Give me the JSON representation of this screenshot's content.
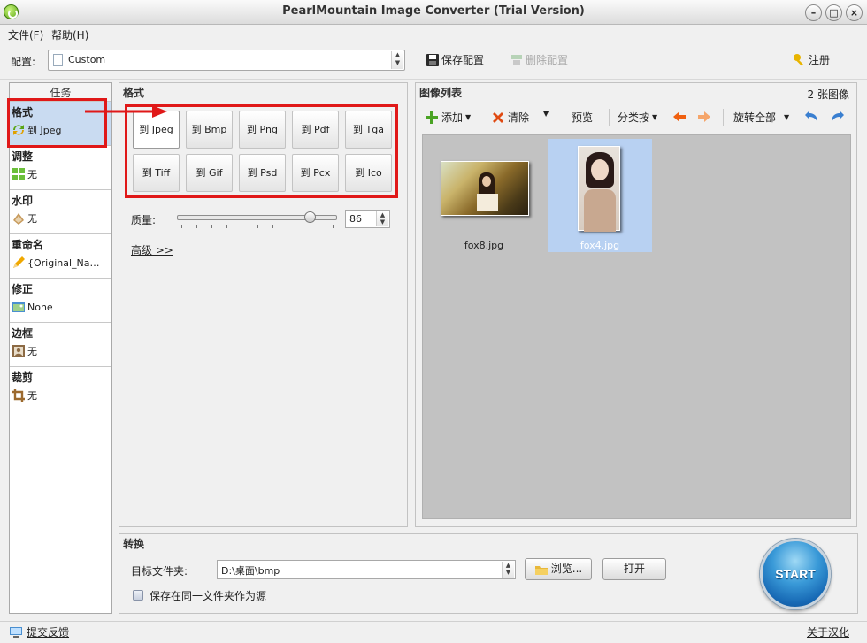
{
  "window": {
    "title": "PearlMountain Image Converter (Trial Version)"
  },
  "menu": {
    "file": "文件(F)",
    "help": "帮助(H)"
  },
  "config": {
    "label": "配置:",
    "value": "Custom",
    "save": "保存配置",
    "delete": "删除配置",
    "register": "注册"
  },
  "tasks": {
    "header": "任务",
    "items": [
      {
        "title": "格式",
        "value": "到 Jpeg",
        "icon": "convert-arrows-icon"
      },
      {
        "title": "调整",
        "value": "无",
        "icon": "resize-grid-icon"
      },
      {
        "title": "水印",
        "value": "无",
        "icon": "watermark-icon"
      },
      {
        "title": "重命名",
        "value": "{Original_Na…",
        "icon": "pencil-icon"
      },
      {
        "title": "修正",
        "value": "None",
        "icon": "picture-adjust-icon"
      },
      {
        "title": "边框",
        "value": "无",
        "icon": "portrait-frame-icon"
      },
      {
        "title": "裁剪",
        "value": "无",
        "icon": "crop-icon"
      }
    ]
  },
  "format": {
    "title": "格式",
    "buttons": [
      "到 Jpeg",
      "到 Bmp",
      "到 Png",
      "到 Pdf",
      "到 Tga",
      "到 Tiff",
      "到 Gif",
      "到 Psd",
      "到 Pcx",
      "到 Ico"
    ],
    "quality_label": "质量:",
    "quality": 86,
    "quality_max": 100,
    "advanced": "高级 >>"
  },
  "image_list": {
    "title": "图像列表",
    "count": "2 张图像",
    "add": "添加",
    "clear": "清除",
    "preview": "预览",
    "sort": "分类按",
    "rotate_all": "旋转全部",
    "images": [
      {
        "name": "fox8.jpg",
        "selected": false
      },
      {
        "name": "fox4.jpg",
        "selected": true
      }
    ]
  },
  "convert": {
    "title": "转换",
    "dest_label": "目标文件夹:",
    "dest_value": "D:\\桌面\\bmp",
    "browse": "浏览...",
    "open": "打开",
    "same_folder": "保存在同一文件夹作为源",
    "start": "START"
  },
  "status": {
    "feedback": "提交反馈",
    "about": "关于汉化"
  },
  "colors": {
    "accent": "#3a9ad8",
    "selection": "#c9dbf1",
    "annotation": "#e01818"
  }
}
